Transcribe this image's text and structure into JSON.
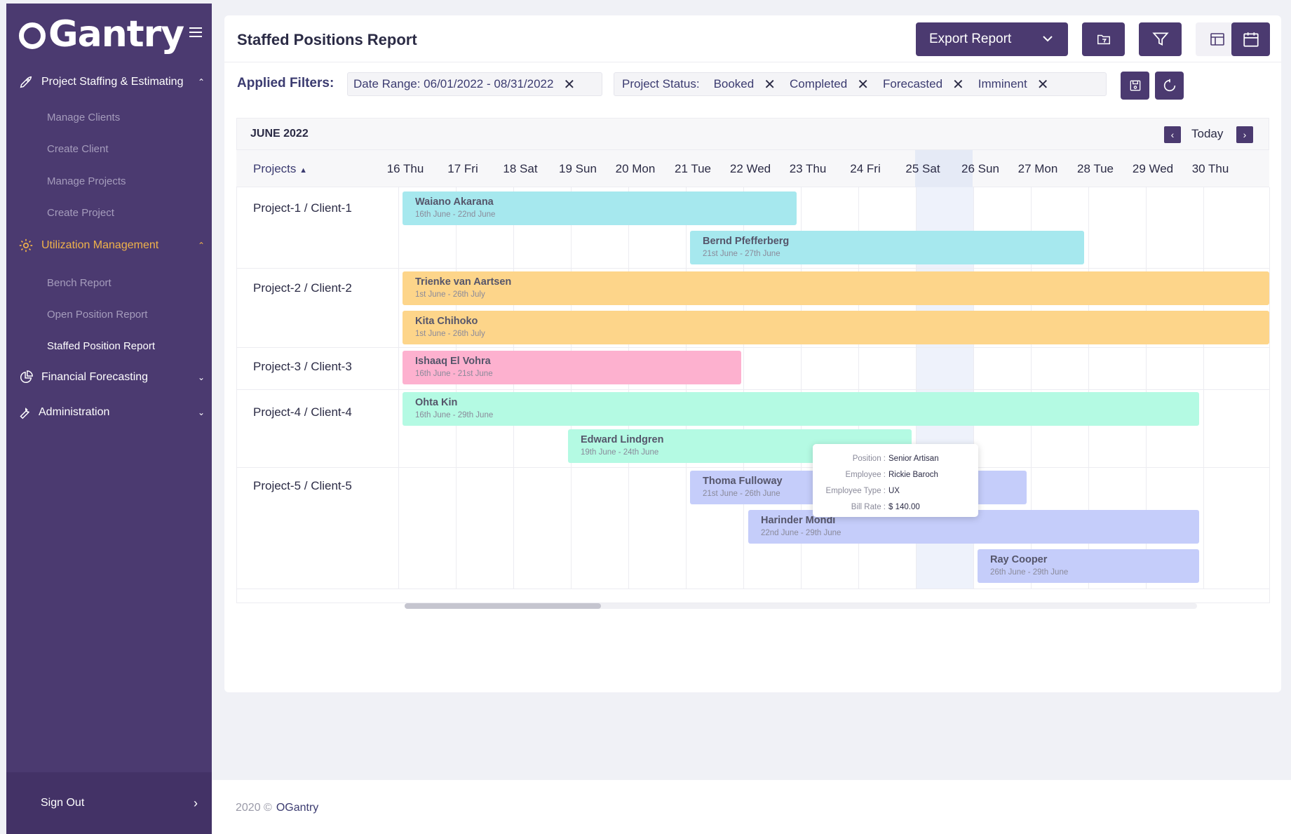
{
  "sidebar": {
    "logo": "Gantry",
    "groups": [
      {
        "label": "Project Staffing & Estimating",
        "icon": "rocket-icon"
      },
      {
        "label": "Utilization Management",
        "icon": "gear-icon"
      },
      {
        "label": "Financial Forecasting",
        "icon": "pie-chart-icon"
      },
      {
        "label": "Administration",
        "icon": "wrench-icon"
      }
    ],
    "staffing_items": [
      "Manage Clients",
      "Create Client",
      "Manage Projects",
      "Create Project"
    ],
    "utilization_items": [
      "Bench Report",
      "Open Position Report",
      "Staffed Position Report"
    ],
    "sign_out": "Sign Out"
  },
  "header": {
    "title": "Staffed Positions Report",
    "export_label": "Export Report"
  },
  "filters": {
    "label": "Applied Filters:",
    "date_range": "Date Range: 06/01/2022 - 08/31/2022",
    "status_label": "Project Status:",
    "statuses": [
      "Booked",
      "Completed",
      "Forecasted",
      "Imminent"
    ]
  },
  "calendar": {
    "month": "JUNE 2022",
    "today_label": "Today",
    "projects_header": "Projects",
    "days": [
      "16 Thu",
      "17 Fri",
      "18 Sat",
      "19 Sun",
      "20 Mon",
      "21 Tue",
      "22 Wed",
      "23 Thu",
      "24 Fri",
      "25 Sat",
      "26 Sun",
      "27 Mon",
      "28 Tue",
      "29 Wed",
      "30 Thu"
    ],
    "highlighted_day": "25 Sat",
    "projects": [
      "Project-1 / Client-1",
      "Project-2 / Client-2",
      "Project-3 / Client-3",
      "Project-4 / Client-4",
      "Project-5 / Client-5"
    ],
    "assignments": [
      {
        "name": "Waiano Akarana",
        "dates": "16th June - 22nd June",
        "color": "#a6e8ee"
      },
      {
        "name": "Bernd Pfefferberg",
        "dates": "21st June - 27th June",
        "color": "#a6e8ee"
      },
      {
        "name": "Trienke van Aartsen",
        "dates": "1st June - 26th July",
        "color": "#fdd58a"
      },
      {
        "name": "Kita Chihoko",
        "dates": "1st June - 26th July",
        "color": "#fdd58a"
      },
      {
        "name": "Ishaaq El Vohra",
        "dates": "16th June - 21st June",
        "color": "#fdb1cf"
      },
      {
        "name": "Ohta Kin",
        "dates": "16th June - 29th June",
        "color": "#b4fae3"
      },
      {
        "name": "Edward Lindgren",
        "dates": "19th June - 24th June",
        "color": "#b4fae3"
      },
      {
        "name": "Thoma Fulloway",
        "dates": "21st June - 26th June",
        "color": "#c5cdfa"
      },
      {
        "name": "Harinder Mondi",
        "dates": "22nd June - 29th June",
        "color": "#c5cdfa"
      },
      {
        "name": "Ray Cooper",
        "dates": "26th June - 29th June",
        "color": "#c5cdfa"
      }
    ]
  },
  "tooltip": {
    "position_label": "Position :",
    "position": "Senior Artisan",
    "employee_label": "Employee :",
    "employee": "Rickie Baroch",
    "type_label": "Employee Type :",
    "type": "UX",
    "rate_label": "Bill Rate :",
    "rate": "$ 140.00"
  },
  "footer": {
    "copyright": "2020 ©",
    "brand": "OGantry"
  }
}
